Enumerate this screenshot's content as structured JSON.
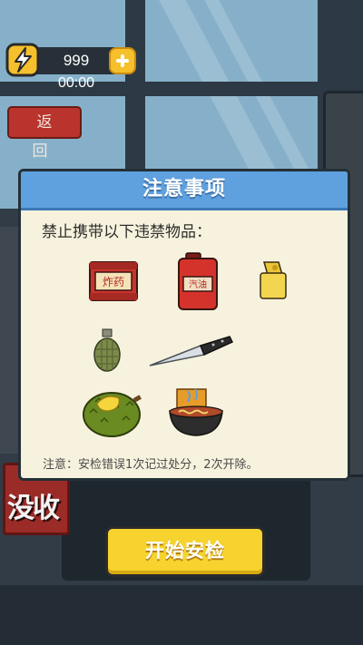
{
  "hud": {
    "energy_count": "999",
    "timer": "00:00",
    "energy_icon": "lightning-icon",
    "add_icon": "plus-icon"
  },
  "back_button": {
    "label": "返 回"
  },
  "dialog": {
    "title": "注意事项",
    "subtitle": "禁止携带以下违禁物品：",
    "note": "注意：安检错误1次记过处分，2次开除。",
    "items": [
      {
        "name": "explosives",
        "icon": "explosives-box-icon",
        "label": "炸药"
      },
      {
        "name": "gasoline",
        "icon": "gas-can-icon",
        "label": "汽油"
      },
      {
        "name": "lighter",
        "icon": "lighter-icon"
      },
      {
        "name": "grenade",
        "icon": "grenade-icon"
      },
      {
        "name": "knife",
        "icon": "knife-icon"
      },
      {
        "name": "durian",
        "icon": "durian-icon"
      },
      {
        "name": "instant-noodles",
        "icon": "noodle-bowl-icon"
      }
    ]
  },
  "background_sign": {
    "label": "没收"
  },
  "start_button": {
    "label": "开始安检"
  },
  "colors": {
    "accent_yellow": "#f6d32e",
    "dialog_header": "#5fa0de",
    "back_red": "#b8342c"
  }
}
